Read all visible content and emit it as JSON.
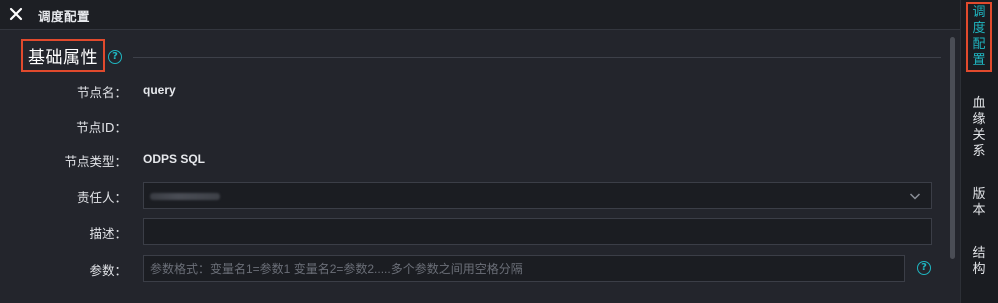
{
  "header": {
    "title": "调度配置",
    "close_icon": "close-icon"
  },
  "section": {
    "title": "基础属性",
    "help_glyph": "?"
  },
  "form": {
    "node_name": {
      "label": "节点名：",
      "value": "query"
    },
    "node_id": {
      "label": "节点ID：",
      "value": ""
    },
    "node_type": {
      "label": "节点类型：",
      "value": "ODPS SQL"
    },
    "owner": {
      "label": "责任人：",
      "value": ""
    },
    "description": {
      "label": "描述：",
      "value": ""
    },
    "params": {
      "label": "参数：",
      "placeholder": "参数格式：变量名1=参数1 变量名2=参数2.....多个参数之间用空格分隔",
      "help_glyph": "?"
    }
  },
  "right_tabs": [
    {
      "chars": [
        "调",
        "度",
        "配",
        "置"
      ],
      "active": true
    },
    {
      "chars": [
        "血",
        "缘",
        "关",
        "系"
      ],
      "active": false
    },
    {
      "chars": [
        "版",
        "本"
      ],
      "active": false
    },
    {
      "chars": [
        "结",
        "构"
      ],
      "active": false
    }
  ],
  "colors": {
    "accent": "#1fb5c0",
    "highlight_border": "#e14a2d",
    "background": "#23252c"
  }
}
